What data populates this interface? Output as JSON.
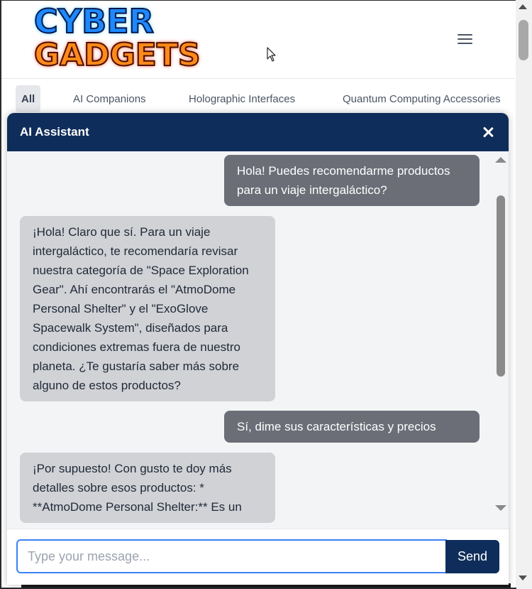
{
  "header": {
    "logo_line1": "CYBER",
    "logo_line2": "GADGETS",
    "menu_icon": "hamburger-menu-icon"
  },
  "tabs": [
    {
      "label": "All",
      "active": true
    },
    {
      "label": "AI Companions",
      "active": false
    },
    {
      "label": "Holographic Interfaces",
      "active": false
    },
    {
      "label": "Quantum Computing Accessories",
      "active": false
    }
  ],
  "chat": {
    "title": "AI Assistant",
    "close_icon": "close-icon",
    "messages": [
      {
        "role": "user",
        "text": "Hola! Puedes recomendarme productos para un viaje intergaláctico?"
      },
      {
        "role": "bot",
        "text": "¡Hola! Claro que sí. Para un viaje intergaláctico, te recomendaría revisar nuestra categoría de \"Space Exploration Gear\". Ahí encontrarás el \"AtmoDome Personal Shelter\" y el \"ExoGlove Spacewalk System\", diseñados para condiciones extremas fuera de nuestro planeta. ¿Te gustaría saber más sobre alguno de estos productos?"
      },
      {
        "role": "user",
        "text": "Sí, dime sus características y precios"
      },
      {
        "role": "bot",
        "text": "¡Por supuesto! Con gusto te doy más detalles sobre esos productos: * **AtmoDome Personal Shelter:** Es un"
      }
    ],
    "input_placeholder": "Type your message...",
    "input_value": "",
    "send_label": "Send"
  },
  "colors": {
    "chat_header_bg": "#0f2d5a",
    "user_bubble": "#6b6e76",
    "bot_bubble": "#d1d2d6",
    "input_focus_border": "#3b82f6"
  }
}
